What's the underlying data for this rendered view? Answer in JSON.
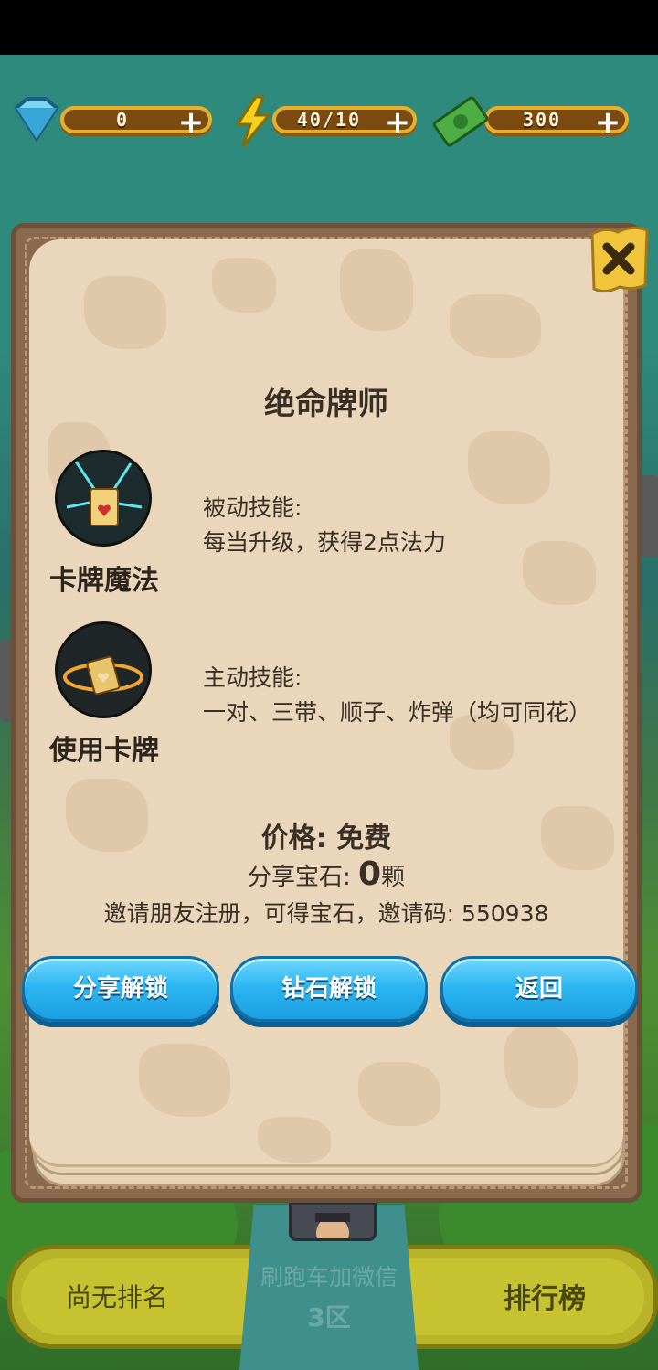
{
  "resources": {
    "gems": {
      "value": "0",
      "icon": "diamond-icon"
    },
    "energy": {
      "value": "40/10",
      "icon": "lightning-icon"
    },
    "cash": {
      "value": "300",
      "icon": "cash-icon"
    }
  },
  "dialog": {
    "title": "绝命牌师",
    "skills": [
      {
        "name": "卡牌魔法",
        "type": "被动技能:",
        "desc": "每当升级，获得2点法力"
      },
      {
        "name": "使用卡牌",
        "type": "主动技能:",
        "desc": "一对、三带、顺子、炸弹（均可同花）"
      }
    ],
    "price_label": "价格: 免费",
    "gem_share_label": "分享宝石: ",
    "gem_share_value": "0",
    "gem_share_unit": "颗",
    "invite_text": "邀请朋友注册，可得宝石，邀请码: 550938",
    "buttons": {
      "share": "分享解锁",
      "diamond": "钻石解锁",
      "back": "返回"
    }
  },
  "bottom": {
    "rank": "尚无排名",
    "server_name": "刷跑车加微信",
    "server_zone": "3区",
    "leaderboard": "排行榜"
  },
  "colors": {
    "button_blue": "#2db6f2",
    "page": "#ead6ba",
    "gold": "#e7b02c"
  }
}
